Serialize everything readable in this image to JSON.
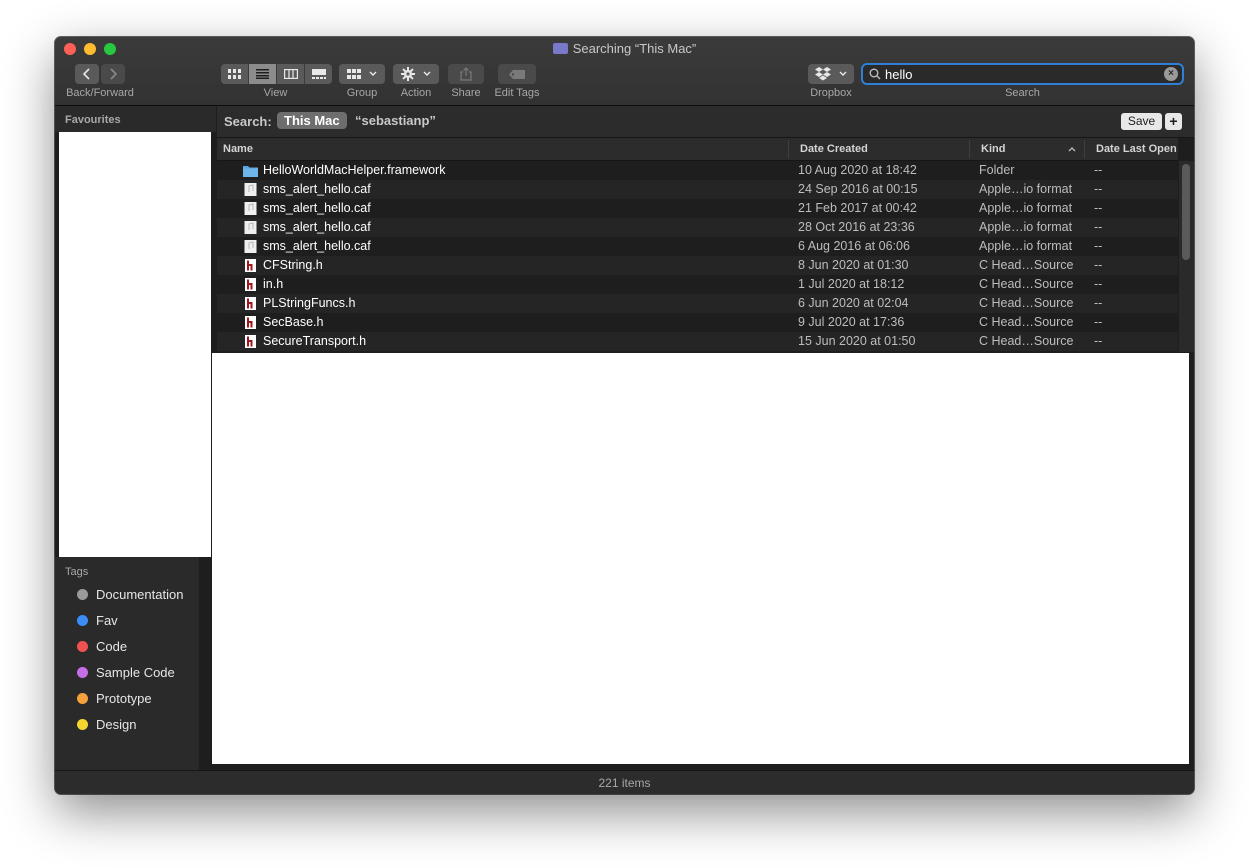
{
  "window": {
    "title": "Searching “This Mac”"
  },
  "toolbar": {
    "back_forward_label": "Back/Forward",
    "view_label": "View",
    "group_label": "Group",
    "action_label": "Action",
    "share_label": "Share",
    "edit_tags_label": "Edit Tags",
    "dropbox_label": "Dropbox",
    "search_label": "Search"
  },
  "search": {
    "value": "hello"
  },
  "sidebar": {
    "favourites_heading": "Favourites",
    "tags_heading": "Tags",
    "tags": [
      {
        "label": "Documentation",
        "color": "#9a9a9a"
      },
      {
        "label": "Fav",
        "color": "#3b8cf5"
      },
      {
        "label": "Code",
        "color": "#f05252"
      },
      {
        "label": "Sample Code",
        "color": "#c46ee8"
      },
      {
        "label": "Prototype",
        "color": "#f5a23c"
      },
      {
        "label": "Design",
        "color": "#f7d531"
      }
    ]
  },
  "scope": {
    "label": "Search:",
    "this_mac": "This Mac",
    "user": "“sebastianp”",
    "save": "Save",
    "add": "+"
  },
  "columns": {
    "name": "Name",
    "date_created": "Date Created",
    "kind": "Kind",
    "date_last_opened": "Date Last Open"
  },
  "files": [
    {
      "name": "HelloWorldMacHelper.framework",
      "date": "10 Aug 2020 at 18:42",
      "kind": "Folder",
      "opened": "--",
      "icon": "folder"
    },
    {
      "name": "sms_alert_hello.caf",
      "date": "24 Sep 2016 at 00:15",
      "kind": "Apple…io format",
      "opened": "--",
      "icon": "audio"
    },
    {
      "name": "sms_alert_hello.caf",
      "date": "21 Feb 2017 at 00:42",
      "kind": "Apple…io format",
      "opened": "--",
      "icon": "audio"
    },
    {
      "name": "sms_alert_hello.caf",
      "date": "28 Oct 2016 at 23:36",
      "kind": "Apple…io format",
      "opened": "--",
      "icon": "audio"
    },
    {
      "name": "sms_alert_hello.caf",
      "date": "6 Aug 2016 at 06:06",
      "kind": "Apple…io format",
      "opened": "--",
      "icon": "audio"
    },
    {
      "name": "CFString.h",
      "date": "8 Jun 2020 at 01:30",
      "kind": "C Head…Source",
      "opened": "--",
      "icon": "header"
    },
    {
      "name": "in.h",
      "date": "1 Jul 2020 at 18:12",
      "kind": "C Head…Source",
      "opened": "--",
      "icon": "header"
    },
    {
      "name": "PLStringFuncs.h",
      "date": "6 Jun 2020 at 02:04",
      "kind": "C Head…Source",
      "opened": "--",
      "icon": "header"
    },
    {
      "name": "SecBase.h",
      "date": "9 Jul 2020 at 17:36",
      "kind": "C Head…Source",
      "opened": "--",
      "icon": "header"
    },
    {
      "name": "SecureTransport.h",
      "date": "15 Jun 2020 at 01:50",
      "kind": "C Head…Source",
      "opened": "--",
      "icon": "header"
    }
  ],
  "status": {
    "item_count": "221 items"
  }
}
